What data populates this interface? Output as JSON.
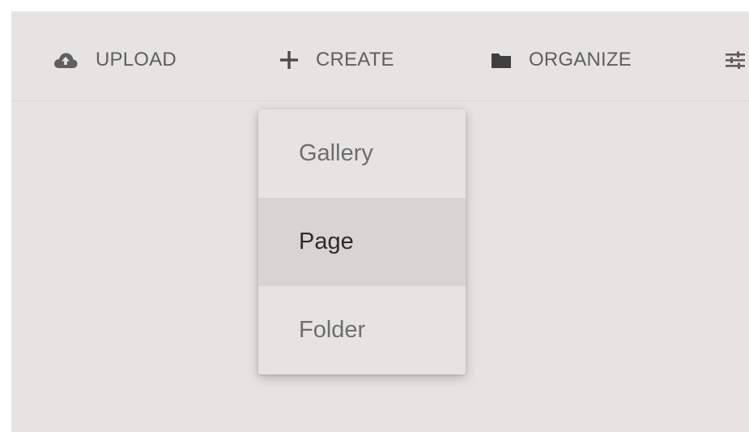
{
  "toolbar": {
    "items": [
      {
        "label": "UPLOAD",
        "icon": "cloud-upload-icon"
      },
      {
        "label": "CREATE",
        "icon": "plus-icon"
      },
      {
        "label": "ORGANIZE",
        "icon": "folder-icon"
      },
      {
        "label": "",
        "icon": "sliders-icon"
      }
    ]
  },
  "create_menu": {
    "items": [
      {
        "label": "Gallery",
        "highlighted": false
      },
      {
        "label": "Page",
        "highlighted": true
      },
      {
        "label": "Folder",
        "highlighted": false
      }
    ]
  },
  "colors": {
    "background": "#e6e4e2",
    "text": "#5f5f5f",
    "highlight": "#d7d5d3"
  }
}
